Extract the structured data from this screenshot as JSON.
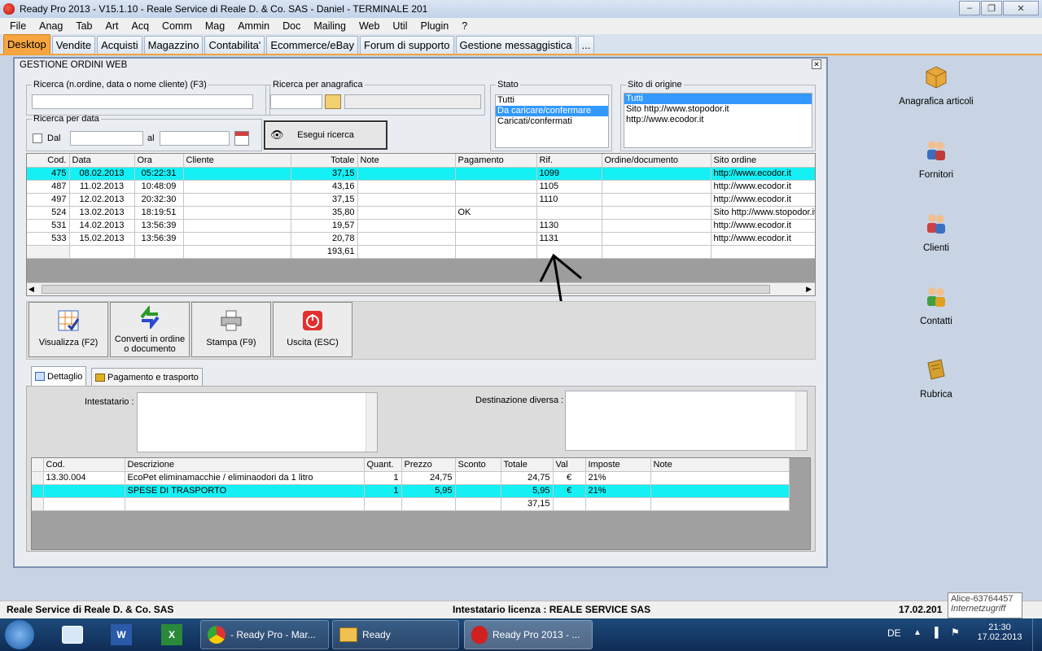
{
  "window": {
    "title": "Ready Pro 2013 - V15.1.10 - Reale Service di Reale D. & Co. SAS - Daniel - TERMINALE 201"
  },
  "menu": [
    "File",
    "Anag",
    "Tab",
    "Art",
    "Acq",
    "Comm",
    "Mag",
    "Ammin",
    "Doc",
    "Mailing",
    "Web",
    "Util",
    "Plugin",
    "?"
  ],
  "tabs": [
    "Desktop",
    "Vendite",
    "Acquisti",
    "Magazzino",
    "Contabilita'",
    "Ecommerce/eBay",
    "Forum di supporto",
    "Gestione messaggistica",
    "..."
  ],
  "desktop_icons": [
    {
      "label": "Anagrafica articoli",
      "icon": "box-icon"
    },
    {
      "label": "Fornitori",
      "icon": "suppliers-icon"
    },
    {
      "label": "Clienti",
      "icon": "customers-icon"
    },
    {
      "label": "Contatti",
      "icon": "contacts-icon"
    },
    {
      "label": "Rubrica",
      "icon": "addressbook-icon"
    }
  ],
  "panel": {
    "title": "GESTIONE ORDINI WEB",
    "search_label": "Ricerca (n.ordine, data o nome cliente) (F3)",
    "search_value": "",
    "anag_label": "Ricerca per anagrafica",
    "date_label": "Ricerca per data",
    "dal_label": "Dal",
    "al_label": "al",
    "search_button": "Esegui ricerca",
    "stato_label": "Stato",
    "stato_items": [
      "Tutti",
      "Da caricare/confermare",
      "Caricati/confermati"
    ],
    "stato_selected": 1,
    "sito_label": "Sito di origine",
    "sito_items": [
      "Tutti",
      "Sito http://www.stopodor.it",
      "http://www.ecodor.it"
    ],
    "sito_selected": 0
  },
  "orders": {
    "columns": [
      "Cod.",
      "Data",
      "Ora",
      "Cliente",
      "Totale",
      "Note",
      "Pagamento",
      "Rif.",
      "Ordine/documento",
      "Sito ordine"
    ],
    "rows": [
      {
        "cod": "475",
        "data": "08.02.2013",
        "ora": "05:22:31",
        "cliente": "",
        "totale": "37,15",
        "note": "",
        "pagamento": "",
        "rif": "1099",
        "ordine": "",
        "sito": "http://www.ecodor.it"
      },
      {
        "cod": "487",
        "data": "11.02.2013",
        "ora": "10:48:09",
        "cliente": "",
        "totale": "43,16",
        "note": "",
        "pagamento": "",
        "rif": "1105",
        "ordine": "",
        "sito": "http://www.ecodor.it"
      },
      {
        "cod": "497",
        "data": "12.02.2013",
        "ora": "20:32:30",
        "cliente": "",
        "totale": "37,15",
        "note": "",
        "pagamento": "",
        "rif": "1110",
        "ordine": "",
        "sito": "http://www.ecodor.it"
      },
      {
        "cod": "524",
        "data": "13.02.2013",
        "ora": "18:19:51",
        "cliente": "",
        "totale": "35,80",
        "note": "",
        "pagamento": "OK",
        "rif": "",
        "ordine": "",
        "sito": "Sito http://www.stopodor.it"
      },
      {
        "cod": "531",
        "data": "14.02.2013",
        "ora": "13:56:39",
        "cliente": "",
        "totale": "19,57",
        "note": "",
        "pagamento": "",
        "rif": "1130",
        "ordine": "",
        "sito": "http://www.ecodor.it"
      },
      {
        "cod": "533",
        "data": "15.02.2013",
        "ora": "13:56:39",
        "cliente": "",
        "totale": "20,78",
        "note": "",
        "pagamento": "",
        "rif": "1131",
        "ordine": "",
        "sito": "http://www.ecodor.it"
      }
    ],
    "total": "193,61",
    "highlight_row": 0
  },
  "toolbar": {
    "visualizza": "Visualizza (F2)",
    "converti_1": "Converti in ordine",
    "converti_2": "o documento",
    "stampa": "Stampa (F9)",
    "uscita": "Uscita (ESC)"
  },
  "detail_tabs": [
    "Dettaglio",
    "Pagamento e trasporto"
  ],
  "detail": {
    "intestatario_label": "Intestatario :",
    "destinazione_label": "Destinazione diversa :"
  },
  "lines": {
    "columns": [
      "Cod.",
      "Descrizione",
      "Quant.",
      "Prezzo",
      "Sconto",
      "Totale",
      "Val",
      "Imposte",
      "Note"
    ],
    "rows": [
      {
        "cod": "13.30.004",
        "descr": "EcoPet eliminamacchie / eliminaodori da 1 litro",
        "quant": "1",
        "prezzo": "24,75",
        "sconto": "",
        "totale": "24,75",
        "val": "€",
        "imposte": "21%",
        "note": ""
      },
      {
        "cod": "",
        "descr": "SPESE DI TRASPORTO",
        "quant": "1",
        "prezzo": "5,95",
        "sconto": "",
        "totale": "5,95",
        "val": "€",
        "imposte": "21%",
        "note": ""
      }
    ],
    "total": "37,15",
    "highlight_row": 1
  },
  "status": {
    "company": "Reale Service di Reale D. & Co. SAS",
    "license": "Intestatario licenza : REALE SERVICE SAS",
    "date": "17.02.201"
  },
  "tooltip": {
    "line1": "Alice-63764457",
    "line2": "Internetzugriff"
  },
  "taskbar": {
    "items": [
      "- Ready Pro - Mar...",
      "Ready",
      "Ready Pro 2013 - ..."
    ],
    "lang": "DE",
    "time": "21:30",
    "date": "17.02.2013"
  },
  "colors": {
    "highlight": "#14f0f4",
    "active_tab": "#f6a540",
    "selection": "#3399ff"
  }
}
